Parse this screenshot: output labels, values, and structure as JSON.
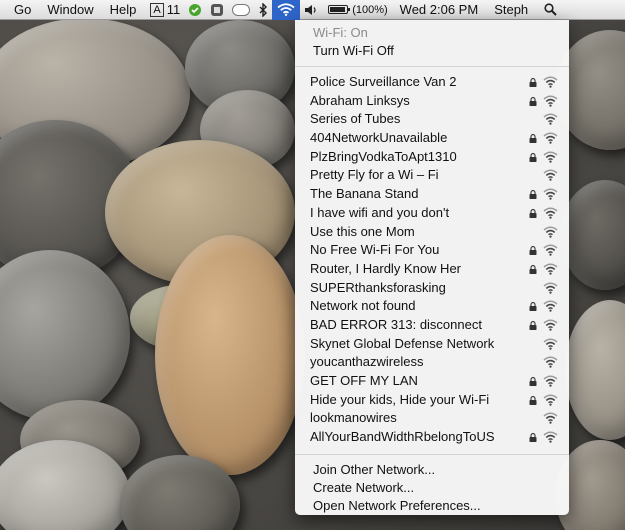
{
  "menubar": {
    "menus": [
      "Go",
      "Window",
      "Help"
    ],
    "status": {
      "input_badge": "A",
      "input_count": "11",
      "battery_text": "(100%)",
      "clock": "Wed 2:06 PM",
      "user": "Steph"
    }
  },
  "wifi_menu": {
    "status_label": "Wi-Fi: On",
    "toggle_label": "Turn Wi-Fi Off",
    "networks": [
      {
        "name": "Police Surveillance Van 2",
        "locked": true
      },
      {
        "name": "Abraham Linksys",
        "locked": true
      },
      {
        "name": "Series of Tubes",
        "locked": false
      },
      {
        "name": "404NetworkUnavailable",
        "locked": true
      },
      {
        "name": "PlzBringVodkaToApt1310",
        "locked": true
      },
      {
        "name": "Pretty Fly for a Wi – Fi",
        "locked": false
      },
      {
        "name": "The Banana Stand",
        "locked": true
      },
      {
        "name": "I have wifi and you don't",
        "locked": true
      },
      {
        "name": "Use this one Mom",
        "locked": false
      },
      {
        "name": "No Free Wi-Fi For You",
        "locked": true
      },
      {
        "name": "Router, I Hardly Know Her",
        "locked": true
      },
      {
        "name": "SUPERthanksforasking",
        "locked": false
      },
      {
        "name": "Network not found",
        "locked": true
      },
      {
        "name": "BAD ERROR 313: disconnect",
        "locked": true
      },
      {
        "name": "Skynet Global Defense Network",
        "locked": false
      },
      {
        "name": "youcanthazwireless",
        "locked": false
      },
      {
        "name": "GET OFF MY LAN",
        "locked": true
      },
      {
        "name": "Hide your kids, Hide your Wi-Fi",
        "locked": true
      },
      {
        "name": "lookmanowires",
        "locked": false
      },
      {
        "name": "AllYourBandWidthRbelongToUS",
        "locked": true
      }
    ],
    "actions": [
      "Join Other Network...",
      "Create Network...",
      "Open Network Preferences..."
    ]
  },
  "colors": {
    "wifi_status_highlight": "#2e65c9",
    "menu_background": "#f8f8f8",
    "disabled_text": "#8a8a8a"
  }
}
